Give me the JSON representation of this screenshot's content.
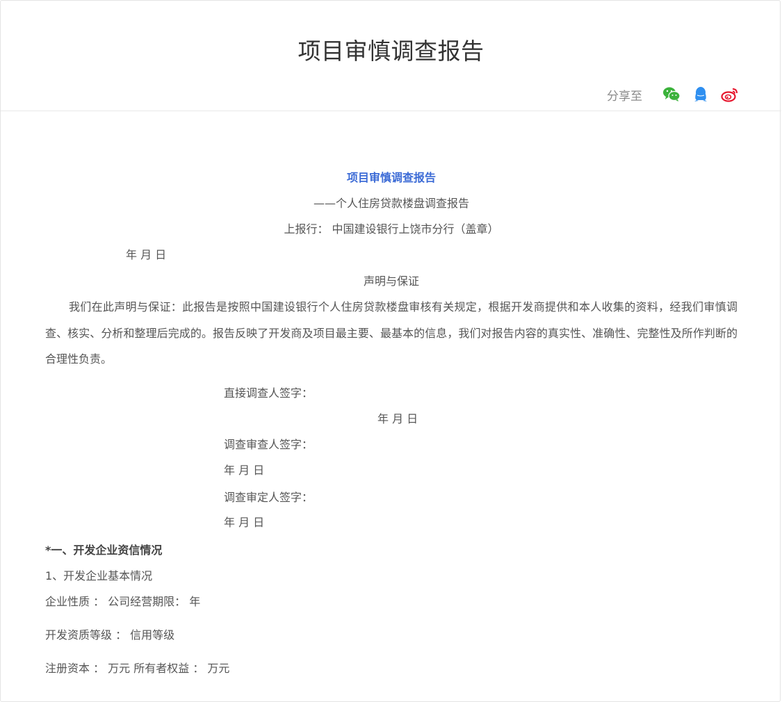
{
  "page": {
    "title": "项目审慎调查报告"
  },
  "share": {
    "label": "分享至",
    "icons": [
      "wechat-icon",
      "qq-icon",
      "weibo-icon"
    ]
  },
  "document": {
    "title": "项目审慎调查报告",
    "subtitle": "——个人住房贷款楼盘调查报告",
    "report_to": "上报行： 中国建设银行上饶市分行（盖章）",
    "date_1": "年 月 日",
    "declaration_heading": "声明与保证",
    "declaration_body": "我们在此声明与保证：此报告是按照中国建设银行个人住房贷款楼盘审核有关规定，根据开发商提供和本人收集的资料，经我们审慎调查、核实、分析和整理后完成的。报告反映了开发商及项目最主要、最基本的信息，我们对报告内容的真实性、准确性、完整性及所作判断的合理性负责。",
    "signatures": [
      {
        "label": "直接调查人签字：",
        "date": "年 月 日"
      },
      {
        "label": "调查审查人签字：",
        "date": "年 月 日"
      },
      {
        "label": "调查审定人签字：",
        "date": "年 月 日"
      }
    ],
    "section_1_heading": "*一、开发企业资信情况",
    "section_1_1": "1、开发企业基本情况",
    "fields": [
      "企业性质 ： 公司经营期限： 年",
      "开发资质等级 ： 信用等级",
      "注册资本 ： 万元 所有者权益 ： 万元"
    ]
  },
  "colors": {
    "doc_title": "#3c6bd6",
    "wechat": "#3bb23b",
    "qq": "#2f8ff0",
    "weibo": "#e6162d"
  }
}
